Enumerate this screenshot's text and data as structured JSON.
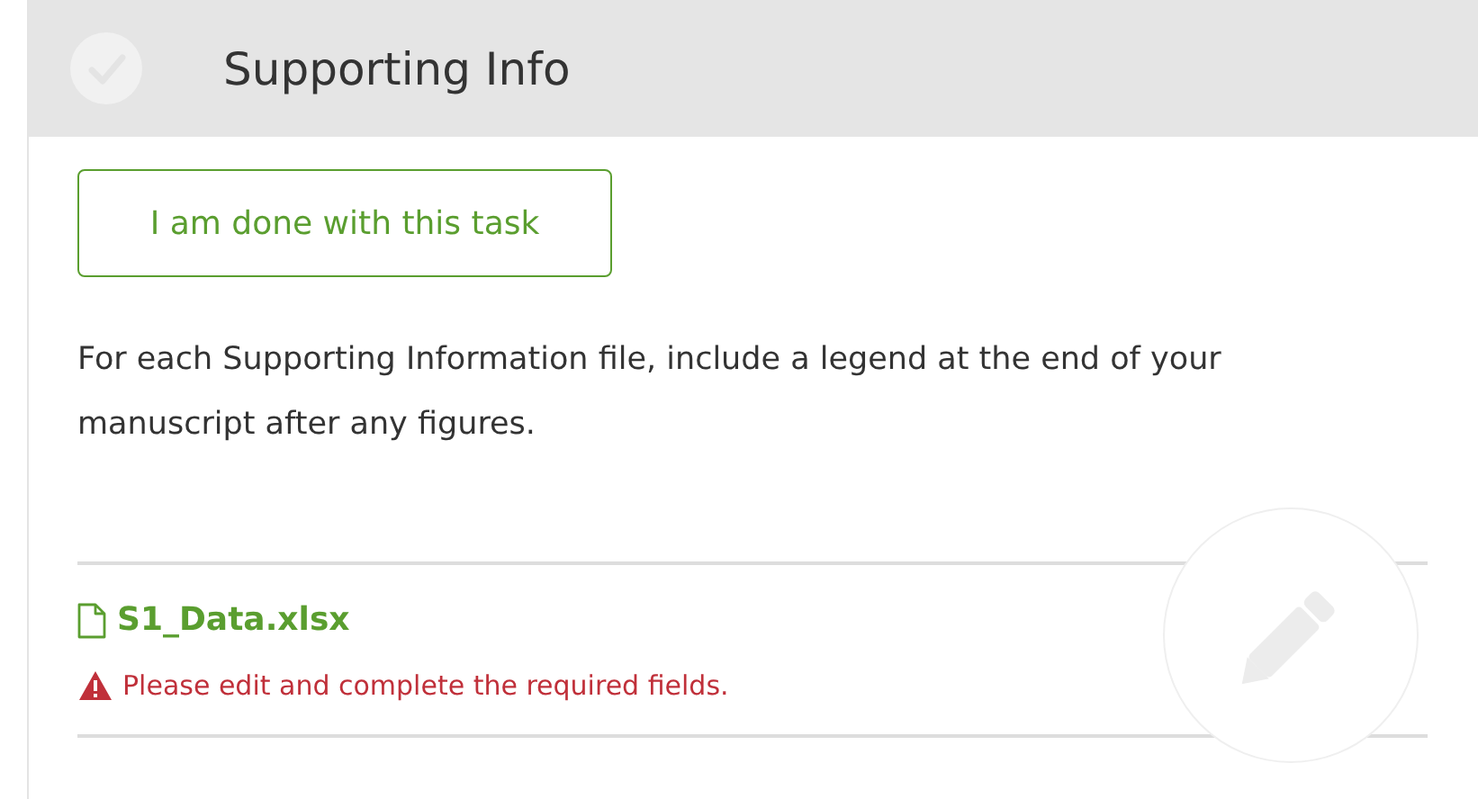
{
  "task": {
    "title": "Supporting Info",
    "completed": false
  },
  "done_button": {
    "label": "I am done with this task"
  },
  "instructions": "For each Supporting Information file, include a legend at the end of your manuscript after any figures.",
  "files": [
    {
      "name": "S1_Data.xlsx",
      "error": "Please edit and complete the required fields."
    }
  ]
}
